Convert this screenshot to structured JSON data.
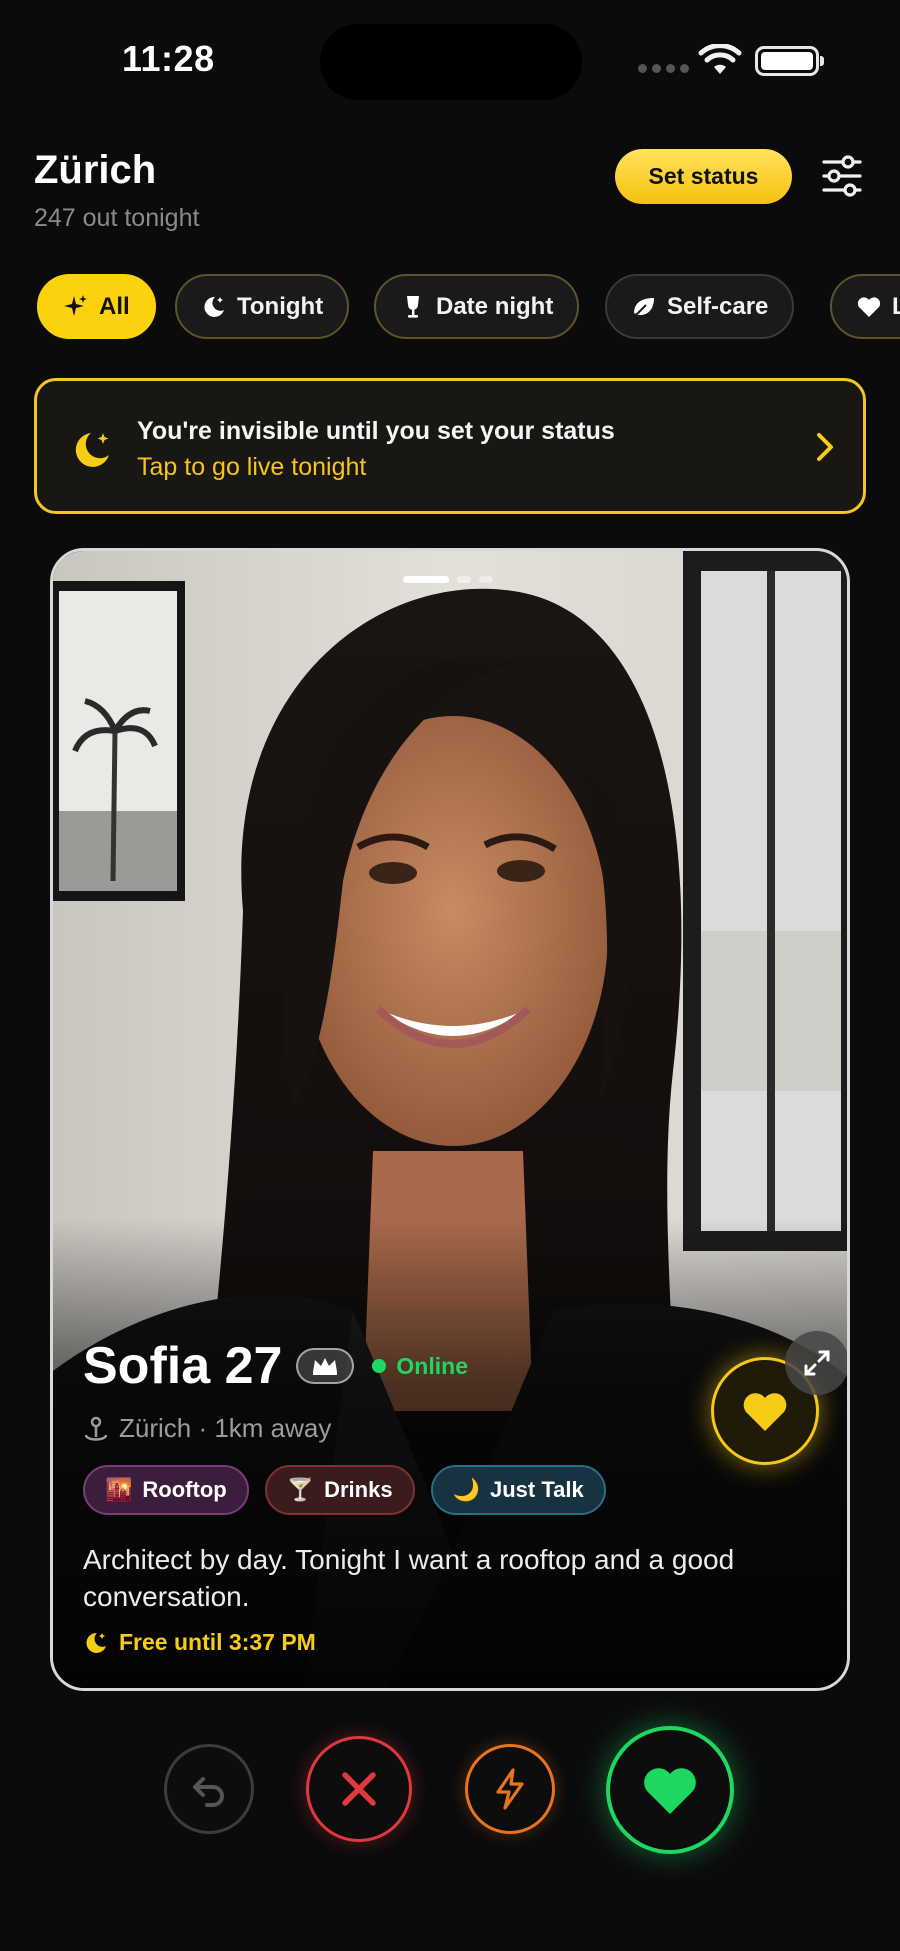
{
  "status_bar": {
    "time": "11:28"
  },
  "header": {
    "city": "Zürich",
    "out_tonight": "247 out tonight",
    "set_status_label": "Set status"
  },
  "chips": [
    {
      "label": "All",
      "icon": "sparkle-icon",
      "active": true
    },
    {
      "label": "Tonight",
      "icon": "moon-icon"
    },
    {
      "label": "Date night",
      "icon": "wine-glass-icon"
    },
    {
      "label": "Self-care",
      "icon": "leaf-icon"
    },
    {
      "label": "L",
      "icon": "heart-icon"
    }
  ],
  "banner": {
    "title": "You're invisible until you set your status",
    "subtitle": "Tap to go live tonight"
  },
  "profile": {
    "name_age": "Sofia 27",
    "online": "Online",
    "location": "Zürich · 1km away",
    "tags": [
      {
        "label": "Rooftop",
        "emoji": "🌇"
      },
      {
        "label": "Drinks",
        "emoji": "🍸"
      },
      {
        "label": "Just Talk",
        "emoji": "🌙"
      }
    ],
    "bio": "Architect by day. Tonight I want a rooftop and a good conversation.",
    "free_until": "Free until 3:37 PM",
    "photo_count": 3,
    "current_photo": 1
  },
  "colors": {
    "accent": "#fcd20e",
    "online": "#1ed760",
    "nope": "#e0383e",
    "boost": "#e8731c",
    "like": "#1ed760",
    "background": "#0b0b0c"
  }
}
